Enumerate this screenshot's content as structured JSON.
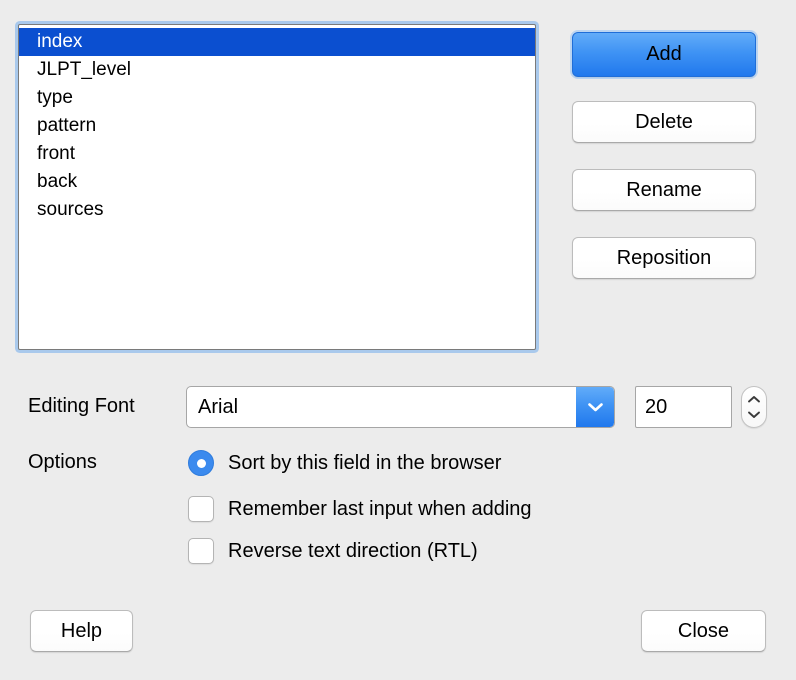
{
  "fields": {
    "items": [
      {
        "label": "index",
        "selected": true
      },
      {
        "label": "JLPT_level",
        "selected": false
      },
      {
        "label": "type",
        "selected": false
      },
      {
        "label": "pattern",
        "selected": false
      },
      {
        "label": "front",
        "selected": false
      },
      {
        "label": "back",
        "selected": false
      },
      {
        "label": "sources",
        "selected": false
      }
    ]
  },
  "buttons": {
    "add": "Add",
    "delete": "Delete",
    "rename": "Rename",
    "reposition": "Reposition",
    "help": "Help",
    "close": "Close"
  },
  "font_row": {
    "label": "Editing Font",
    "family_value": "Arial",
    "size_value": "20"
  },
  "options": {
    "label": "Options",
    "items": [
      {
        "label": "Sort by this field in the browser",
        "control": "radio",
        "checked": true
      },
      {
        "label": "Remember last input when adding",
        "control": "checkbox",
        "checked": false
      },
      {
        "label": "Reverse text direction (RTL)",
        "control": "checkbox",
        "checked": false
      }
    ]
  },
  "colors": {
    "window_background": "#ececec",
    "selection_blue": "#0b4fd0",
    "accent_blue": "#3b8aee",
    "focus_ring": "#a9c9ec"
  },
  "icons": {
    "chevron_down": "chevron-down-icon",
    "stepper_up": "chevron-up-icon",
    "stepper_down": "chevron-down-icon"
  }
}
